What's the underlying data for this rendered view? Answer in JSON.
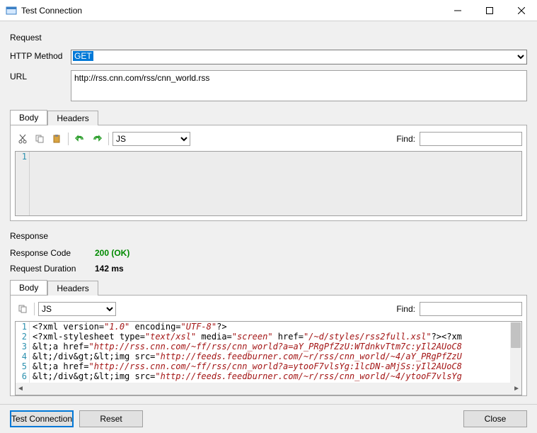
{
  "window": {
    "title": "Test Connection"
  },
  "request": {
    "section_label": "Request",
    "http_method_label": "HTTP Method",
    "http_method_value": "GET",
    "url_label": "URL",
    "url_value": "http://rss.cnn.com/rss/cnn_world.rss",
    "tabs": {
      "body": "Body",
      "headers": "Headers"
    },
    "toolbar": {
      "lang": "JS",
      "find_label": "Find:"
    },
    "body_lines": [
      "1"
    ]
  },
  "response": {
    "section_label": "Response",
    "code_label": "Response Code",
    "code_value": "200 (OK)",
    "duration_label": "Request Duration",
    "duration_value": "142 ms",
    "tabs": {
      "body": "Body",
      "headers": "Headers"
    },
    "toolbar": {
      "lang": "JS",
      "find_label": "Find:"
    },
    "body": {
      "lines": [
        "1",
        "2",
        "3",
        "4",
        "5",
        "6"
      ],
      "l1a": "<?xml version=",
      "l1b": "\"1.0\"",
      "l1c": " encoding=",
      "l1d": "\"UTF-8\"",
      "l1e": "?>",
      "l2a": "<?xml-stylesheet type=",
      "l2b": "\"text/xsl\"",
      "l2c": " media=",
      "l2d": "\"screen\"",
      "l2e": " href=",
      "l2f": "\"/~d/styles/rss2full.xsl\"",
      "l2g": "?><?xm",
      "l3a": "&lt;a href=",
      "l3b": "\"http://rss.cnn.com/~ff/rss/cnn_world?a=aY_PRgPfZzU:WTdnkvTtm7c:yIl2AUoC8",
      "l4a": "&lt;/div&gt;&lt;img src=",
      "l4b": "\"http://feeds.feedburner.com/~r/rss/cnn_world/~4/aY_PRgPfZzU",
      "l5a": "&lt;a href=",
      "l5b": "\"http://rss.cnn.com/~ff/rss/cnn_world?a=ytooF7vlsYg:1lcDN-aMjSs:yIl2AUoC8",
      "l6a": "&lt;/div&gt;&lt;img src=",
      "l6b": "\"http://feeds.feedburner.com/~r/rss/cnn_world/~4/ytooF7vlsYg"
    }
  },
  "buttons": {
    "test": "Test Connection",
    "reset": "Reset",
    "close": "Close"
  }
}
